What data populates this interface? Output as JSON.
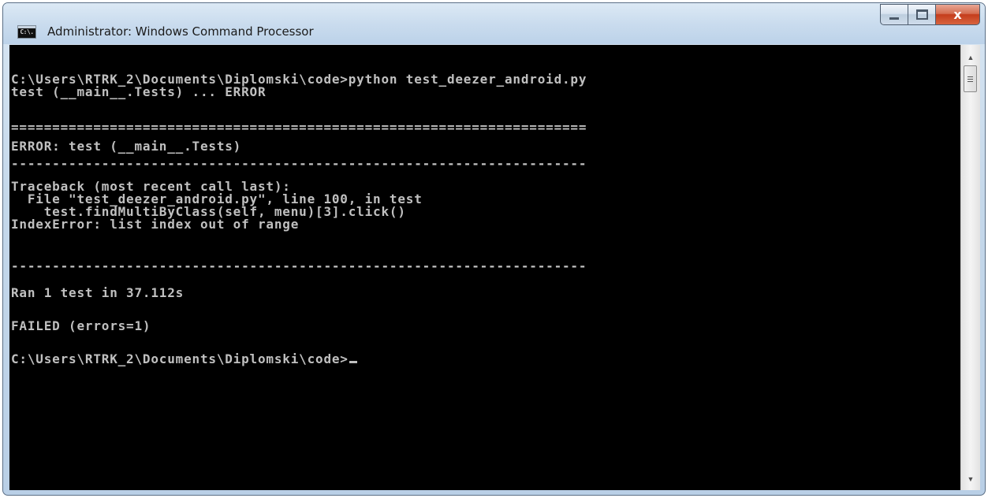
{
  "window": {
    "title": "Administrator: Windows Command Processor",
    "icon_label": "C:\\.",
    "close_label": "x"
  },
  "console": {
    "lines": [
      "C:\\Users\\RTRK_2\\Documents\\Diplomski\\code>python test_deezer_android.py",
      "test (__main__.Tests) ... ERROR",
      "",
      "======================================================================",
      "ERROR: test (__main__.Tests)",
      "----------------------------------------------------------------------",
      "Traceback (most recent call last):",
      "  File \"test_deezer_android.py\", line 100, in test",
      "    test.findMultiByClass(self, menu)[3].click()",
      "IndexError: list index out of range",
      "",
      "----------------------------------------------------------------------",
      "Ran 1 test in 37.112s",
      "",
      "FAILED (errors=1)",
      "",
      "C:\\Users\\RTRK_2\\Documents\\Diplomski\\code>"
    ]
  },
  "colors": {
    "console_bg": "#000000",
    "console_text": "#c0c0c0",
    "close_button": "#c8452a"
  }
}
